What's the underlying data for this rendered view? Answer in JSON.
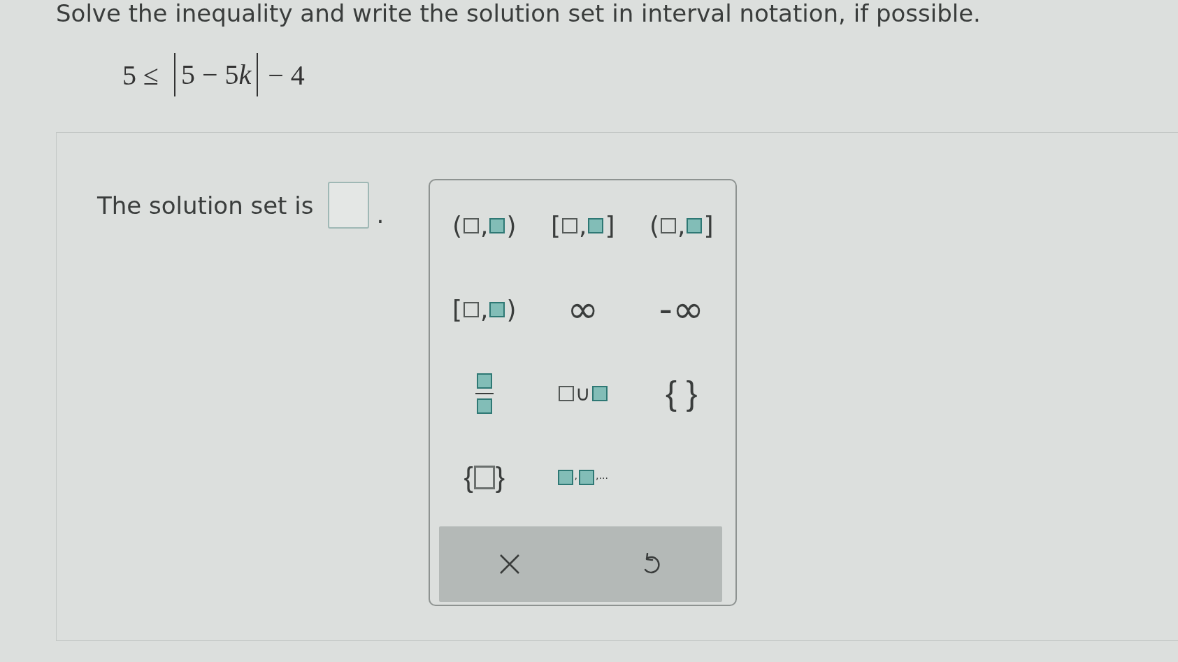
{
  "instruction": "Solve the inequality and write the solution set in interval notation, if possible.",
  "equation": {
    "left": "5 ≤",
    "absolute_value": {
      "text": "5 − 5",
      "variable": "k"
    },
    "right": "− 4"
  },
  "answer": {
    "lead": "The solution set is",
    "after": "."
  },
  "palette": {
    "keys": [
      {
        "kind": "interval",
        "parts": [
          {
            "kind": "text",
            "text": "("
          },
          {
            "kind": "slot",
            "filled": false
          },
          {
            "kind": "text",
            "text": ","
          },
          {
            "kind": "slot",
            "filled": true
          },
          {
            "kind": "text",
            "text": ")"
          }
        ]
      },
      {
        "kind": "interval",
        "parts": [
          {
            "kind": "text",
            "text": "["
          },
          {
            "kind": "slot",
            "filled": false
          },
          {
            "kind": "text",
            "text": ","
          },
          {
            "kind": "slot",
            "filled": true
          },
          {
            "kind": "text",
            "text": "]"
          }
        ]
      },
      {
        "kind": "interval",
        "parts": [
          {
            "kind": "text",
            "text": "("
          },
          {
            "kind": "slot",
            "filled": false
          },
          {
            "kind": "text",
            "text": ","
          },
          {
            "kind": "slot",
            "filled": true
          },
          {
            "kind": "text",
            "text": "]"
          }
        ]
      },
      {
        "kind": "interval",
        "parts": [
          {
            "kind": "text",
            "text": "["
          },
          {
            "kind": "slot",
            "filled": false
          },
          {
            "kind": "text",
            "text": ","
          },
          {
            "kind": "slot",
            "filled": true
          },
          {
            "kind": "text",
            "text": ")"
          }
        ]
      },
      {
        "kind": "infinity",
        "parts": [
          {
            "kind": "text",
            "text": "∞"
          }
        ]
      },
      {
        "kind": "negative-infinity",
        "parts": [
          {
            "kind": "text",
            "text": "-∞"
          }
        ]
      },
      {
        "kind": "fraction",
        "parts": [
          {
            "kind": "fraction",
            "numerator": {
              "filled": true
            },
            "denominator": {
              "filled": true
            }
          }
        ]
      },
      {
        "kind": "union",
        "parts": [
          {
            "kind": "slot",
            "filled": false
          },
          {
            "kind": "text",
            "text": "∪"
          },
          {
            "kind": "slot",
            "filled": true
          }
        ]
      },
      {
        "kind": "empty-set",
        "parts": [
          {
            "kind": "text",
            "text": "{ }"
          }
        ]
      },
      {
        "kind": "set",
        "parts": [
          {
            "kind": "text",
            "text": "{"
          },
          {
            "kind": "large-slot"
          },
          {
            "kind": "text",
            "text": "}"
          }
        ]
      },
      {
        "kind": "sequence",
        "parts": [
          {
            "kind": "slot",
            "filled": true
          },
          {
            "kind": "small-text",
            "text": ","
          },
          {
            "kind": "slot",
            "filled": true
          },
          {
            "kind": "small-text",
            "text": ",..."
          }
        ]
      }
    ],
    "actions": [
      {
        "kind": "clear"
      },
      {
        "kind": "undo"
      }
    ]
  }
}
